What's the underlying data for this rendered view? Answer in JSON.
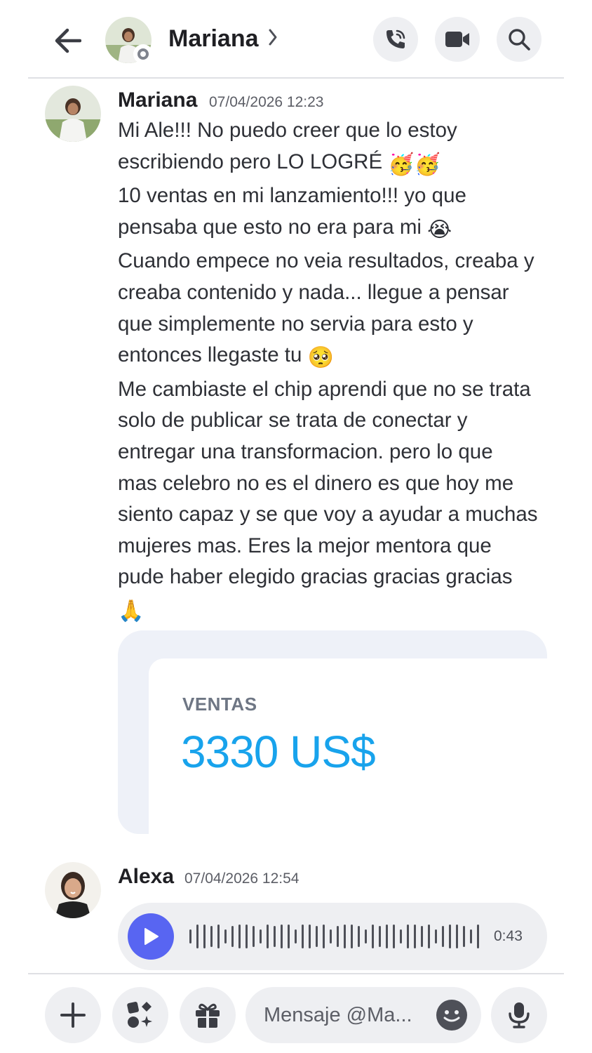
{
  "header": {
    "title": "Mariana",
    "back_icon": "arrow-left-icon",
    "call_icon": "phone-call-icon",
    "video_icon": "video-camera-icon",
    "search_icon": "search-icon",
    "status": "offline"
  },
  "messages": [
    {
      "author": "Mariana",
      "timestamp": "07/04/2026 12:23",
      "lines": [
        "Mi Ale!!! No puedo creer que lo estoy",
        "escribiendo pero LO LOGRÉ",
        "10 ventas en mi lanzamiento!!! yo que",
        "pensaba que esto no era para mi",
        "Cuando empece no veia resultados, creaba y",
        "creaba contenido y nada... llegue a pensar",
        "que simplemente no servia para esto y",
        "entonces llegaste tu",
        "Me cambiaste el chip aprendi que no se trata",
        "solo de publicar se trata de conectar y",
        "entregar una transformacion. pero lo que",
        "mas celebro no es el dinero es que hoy me",
        "siento capaz y se que voy a ayudar a muchas",
        "mujeres mas. Eres la mejor mentora que",
        "pude haber elegido gracias gracias gracias"
      ],
      "emojis": {
        "party": "🥳🥳",
        "crying": "😭",
        "pleading": "🥺",
        "pray": "🙏"
      },
      "attachment": {
        "label": "VENTAS",
        "value": "3330 US$"
      }
    },
    {
      "author": "Alexa",
      "timestamp": "07/04/2026 12:54",
      "voice": {
        "duration": "0:43",
        "play_icon": "play-icon"
      }
    }
  ],
  "composer": {
    "placeholder": "Mensaje @Ma...",
    "add_icon": "plus-icon",
    "apps_icon": "apps-icon",
    "gift_icon": "gift-icon",
    "emoji_icon": "emoji-icon",
    "mic_icon": "microphone-icon"
  },
  "colors": {
    "accent": "#5865f2",
    "sales_value": "#18a3ec",
    "button_bg": "#eeeff2"
  }
}
